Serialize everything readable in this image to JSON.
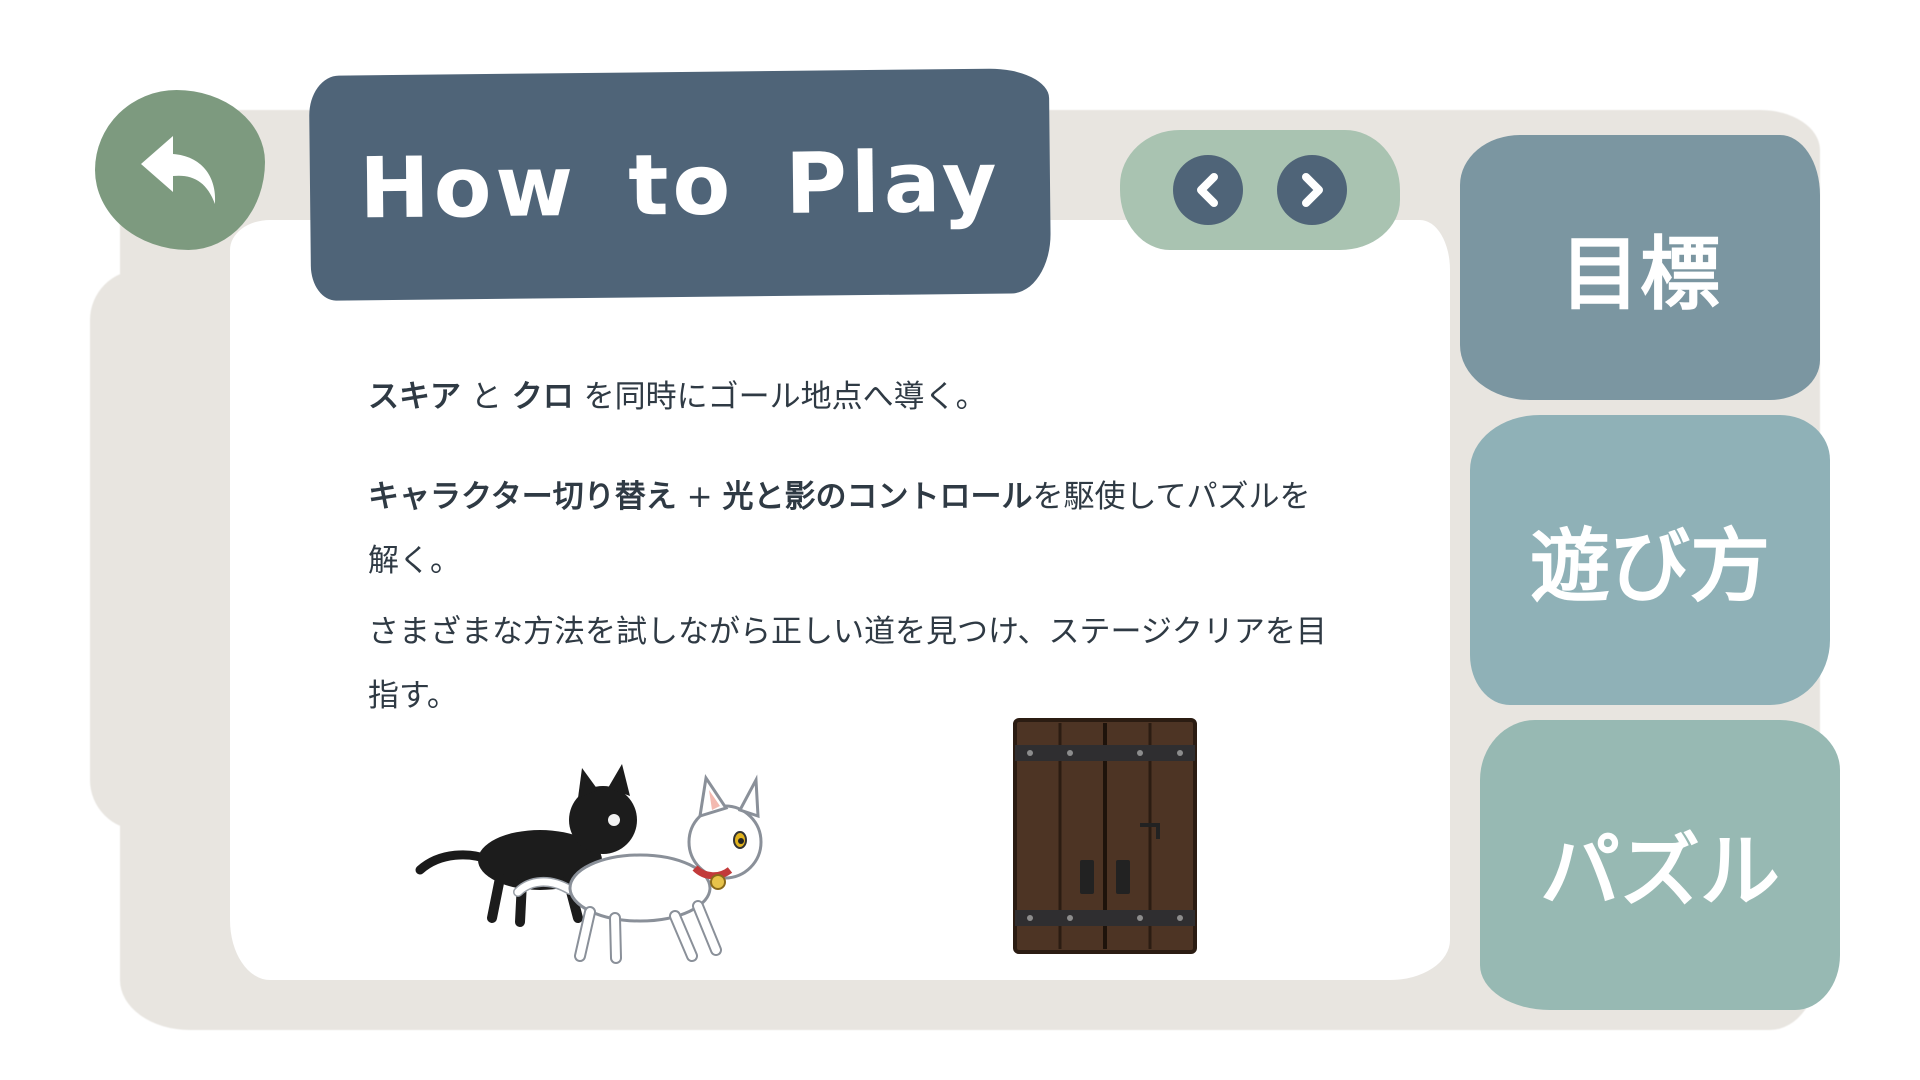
{
  "header": {
    "title": "How to Play",
    "back_icon": "back-arrow-icon",
    "prev_icon": "chevron-left-icon",
    "next_icon": "chevron-right-icon"
  },
  "tabs": [
    {
      "label": "目標"
    },
    {
      "label": "遊び方"
    },
    {
      "label": "パズル"
    }
  ],
  "content": {
    "p1": {
      "name1": "スキア",
      "conn": " と ",
      "name2": "クロ",
      "rest": " を同時にゴール地点へ導く。"
    },
    "p2": {
      "bold1": "キャラクター切り替え",
      "plus": " + ",
      "bold2": "光と影のコントロール",
      "rest": "を駆使してパズルを解く。"
    },
    "p3": "さまざまな方法を試しながら正しい道を見つけ、ステージクリアを目指す。"
  },
  "colors": {
    "title_bg": "#4f6478",
    "back_bg": "#7d9a7f",
    "pager_bg": "#a9c3b1",
    "tab_goal": "#7b96a1",
    "tab_howto": "#8fb1b7",
    "tab_puzzle": "#97b9b3",
    "panel": "#e8e5e0",
    "text": "#2f3a44"
  }
}
